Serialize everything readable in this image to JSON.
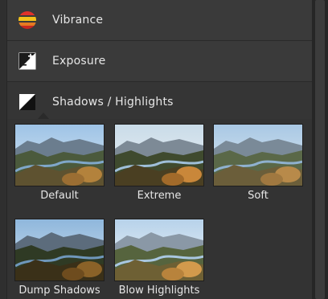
{
  "adjustments": [
    {
      "label": "Vibrance",
      "icon": "vibrance-icon"
    },
    {
      "label": "Exposure",
      "icon": "exposure-icon"
    },
    {
      "label": "Shadows / Highlights",
      "icon": "shadows-highlights-icon"
    }
  ],
  "presets": [
    {
      "label": "Default"
    },
    {
      "label": "Extreme"
    },
    {
      "label": "Soft"
    },
    {
      "label": "Dump Shadows"
    },
    {
      "label": "Blow Highlights"
    }
  ],
  "colors": {
    "panel": "#3a3a3a",
    "text": "#e6e6e6",
    "vibrance_red": "#e0322a",
    "vibrance_yellow": "#f2c21a"
  }
}
